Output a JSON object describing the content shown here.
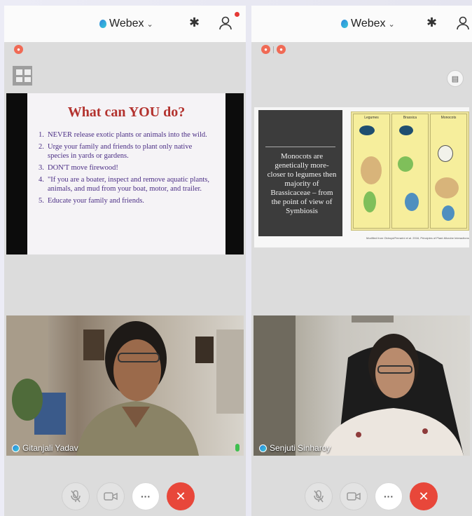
{
  "app": {
    "brand": "Webex",
    "caret": "⌄",
    "bluetooth": "✱"
  },
  "left": {
    "slide": {
      "title": "What can YOU do?",
      "items": [
        {
          "num": "1.",
          "text": "NEVER release exotic plants or animals into the wild."
        },
        {
          "num": "2.",
          "text": "Urge your family and friends to plant only native species in yards or gardens."
        },
        {
          "num": "3.",
          "text": "DON'T move firewood!"
        },
        {
          "num": "4.",
          "text": "\"If you are a boater, inspect and remove aquatic plants, animals, and mud from your boat, motor, and trailer."
        },
        {
          "num": "5.",
          "text": "Educate your family and friends."
        }
      ]
    },
    "participant": "Gitanjali Yadav",
    "controls": {
      "more": "···",
      "end": "✕",
      "mute": "🎙",
      "video": "▭"
    }
  },
  "right": {
    "slide": {
      "card_text": "Monocots are genetically more-closer to legumes then majority of Brassicaceae – from the point of view of Symbiosis",
      "comic_panels": [
        "Legumes",
        "Brassica",
        "Monocots"
      ],
      "caption": "Modified from Oldroyd/Ferrarini et al. 2016, Principles of Plant-Microbe Interactions"
    },
    "participant": "Senjuti Sinharoy",
    "controls": {
      "more": "···",
      "end": "✕",
      "mute": "🎙",
      "video": "▭"
    }
  },
  "colors": {
    "end_call": "#e8473a",
    "slide_title": "#b3322e",
    "slide_text": "#4b2e85"
  }
}
